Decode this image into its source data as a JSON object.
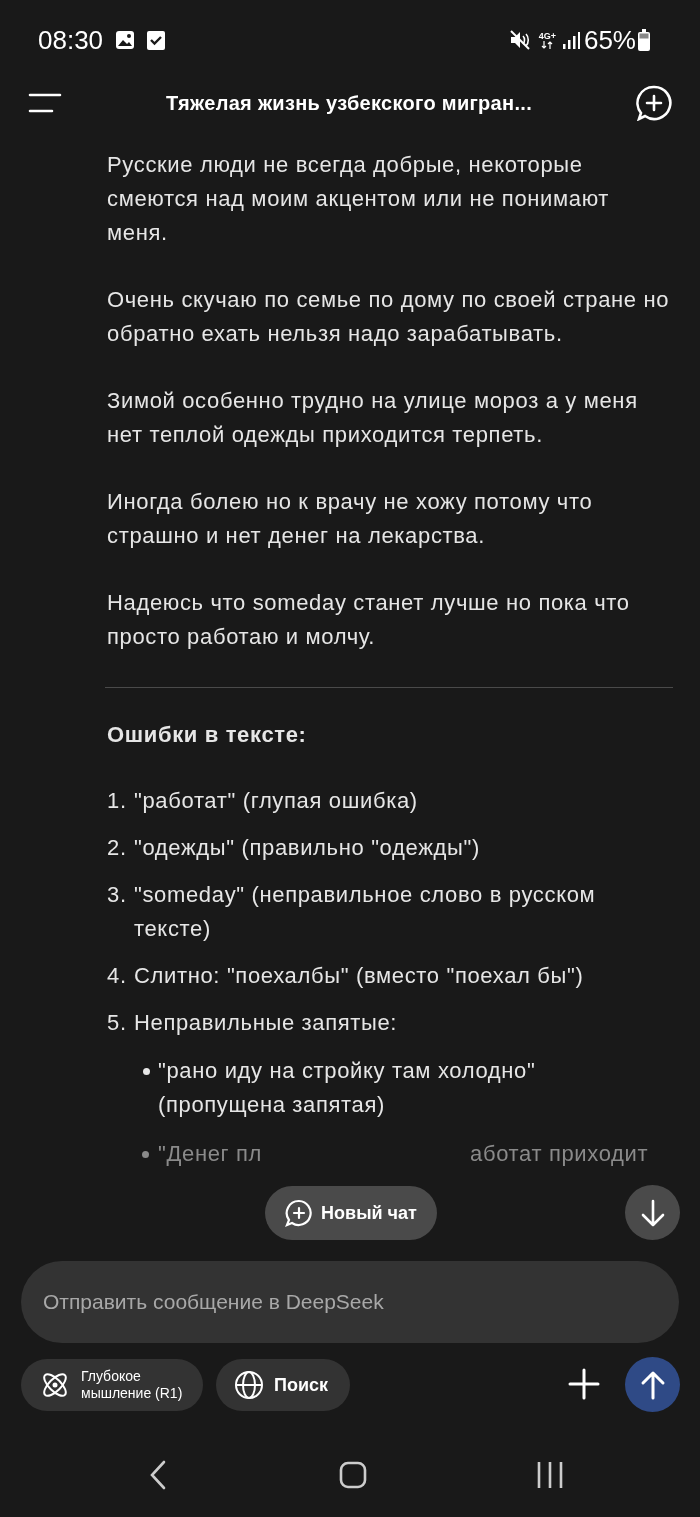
{
  "status_bar": {
    "time": "08:30",
    "network": "4G+",
    "battery": "65%"
  },
  "header": {
    "title": "Тяжелая жизнь узбекского мигран..."
  },
  "paragraphs": [
    "Русские люди не всегда добрые, некоторые смеются над моим акцентом или не понимают меня.",
    "Очень скучаю по семье по дому по своей стране но обратно ехать нельзя надо зарабатывать.",
    "Зимой особенно трудно на улице мороз а у меня нет теплой одежды приходится терпеть.",
    "Иногда болею но к врачу не хожу потому что страшно и нет денег на лекарства.",
    "Надеюсь что someday станет лучше но пока что просто работаю и молчу."
  ],
  "errors_heading": "Ошибки в тексте:",
  "errors": [
    {
      "number": "1.",
      "text": "\"работат\" (глупая ошибка)"
    },
    {
      "number": "2.",
      "text": "\"одежды\" (правильно \"одежды\")"
    },
    {
      "number": "3.",
      "text": "\"someday\" (неправильное слово в русском тексте)"
    },
    {
      "number": "4.",
      "text": "Слитно: \"поехалбы\" (вместо \"поехал бы\")"
    },
    {
      "number": "5.",
      "text": "Неправильные запятые:",
      "children": [
        {
          "text": "\"рано иду на стройку там холодно\" (пропущена запятая)"
        },
        {
          "visible_start": "\"Денег пл",
          "visible_end": "аботат приходит"
        }
      ]
    }
  ],
  "new_chat_button": "Новый чат",
  "input": {
    "placeholder": "Отправить сообщение в DeepSeek"
  },
  "chips": [
    {
      "kind": "deepthink",
      "label": "Глубокое мышление (R1)"
    },
    {
      "kind": "search",
      "label": "Поиск"
    }
  ]
}
